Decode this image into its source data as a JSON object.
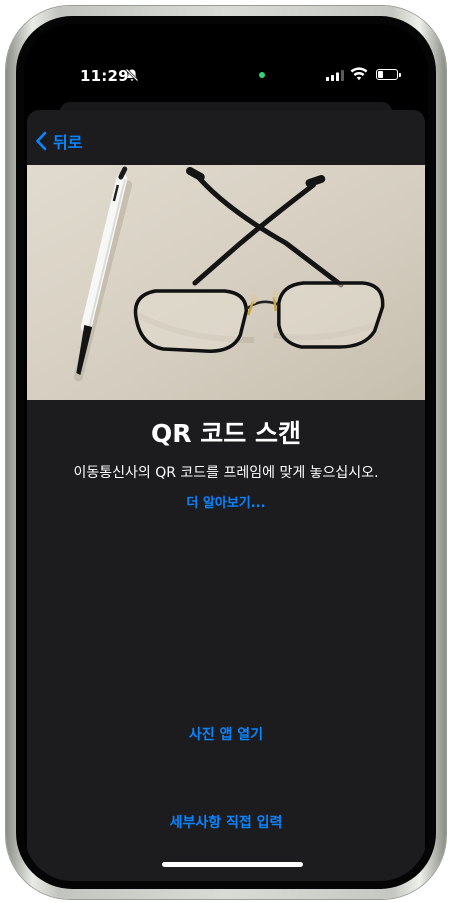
{
  "status_bar": {
    "time": "11:29",
    "icons": [
      "silent-bell-icon",
      "signal-bars-icon",
      "wifi-icon",
      "battery-icon"
    ],
    "camera_indicator_color": "#33d17a"
  },
  "nav": {
    "back_label": "뒤로"
  },
  "content": {
    "title": "QR 코드 스캔",
    "subtitle": "이동통신사의 QR 코드를 프레임에 맞게 놓으십시오.",
    "learn_more": "더 알아보기..."
  },
  "actions": {
    "open_photos": "사진 앱 열기",
    "enter_manually": "세부사항 직접 입력"
  },
  "colors": {
    "accent": "#0a84ff",
    "sheet_background": "#1c1c1e",
    "text": "#ffffff"
  }
}
